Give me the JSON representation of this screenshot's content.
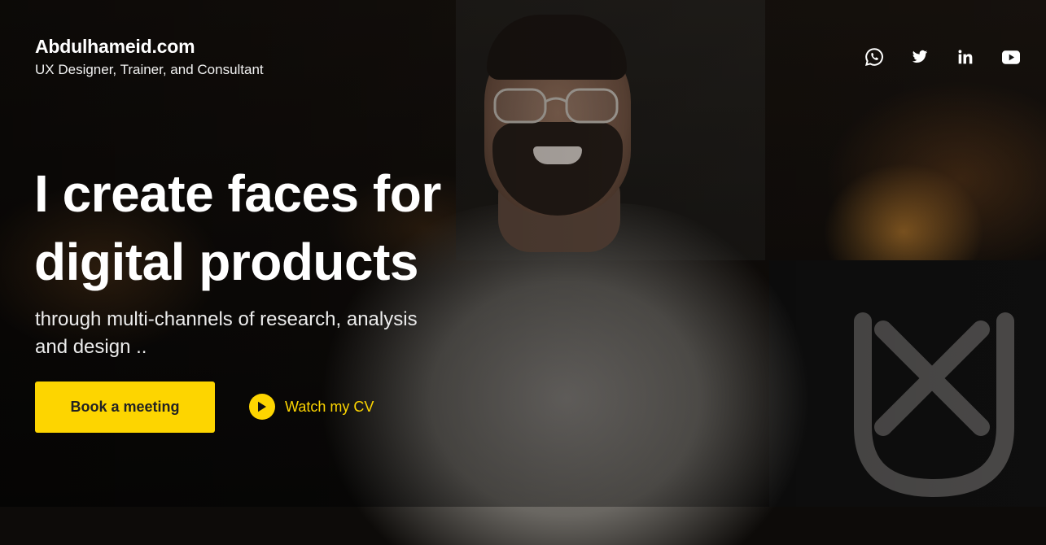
{
  "header": {
    "brand_title": "Abdulhameid.com",
    "brand_subtitle": "UX Designer, Trainer, and Consultant"
  },
  "socials": [
    {
      "name": "whatsapp-icon"
    },
    {
      "name": "twitter-icon"
    },
    {
      "name": "linkedin-icon"
    },
    {
      "name": "youtube-icon"
    }
  ],
  "hero": {
    "headline_line1": "I create faces for",
    "headline_line2": "digital products",
    "tagline_line1": "through multi-channels of research, analysis",
    "tagline_line2": "and design ..",
    "primary_cta": "Book a meeting",
    "secondary_cta": "Watch my CV"
  },
  "colors": {
    "accent": "#fdd500",
    "background": "#0d0b09",
    "text": "#ffffff"
  },
  "icons": {
    "play": "play-icon",
    "background_logo": "ux-logo"
  }
}
